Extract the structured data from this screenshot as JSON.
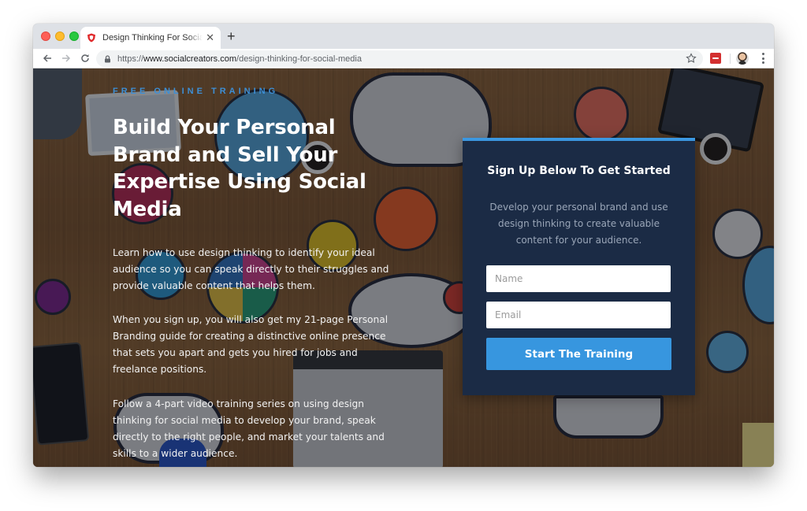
{
  "browser": {
    "tab": {
      "title": "Design Thinking For Social Media",
      "favicon": "shield-favicon-icon",
      "close_glyph": "✕"
    },
    "new_tab_glyph": "+",
    "address": {
      "scheme": "https://",
      "host": "www.socialcreators.com",
      "path": "/design-thinking-for-social-media"
    },
    "icons": {
      "back": "arrow-left-icon",
      "forward": "arrow-right-icon",
      "reload": "reload-icon",
      "lock": "lock-icon",
      "bookmark": "star-icon",
      "extension": "extension-icon",
      "profile": "avatar",
      "menu": "kebab-menu-icon"
    }
  },
  "hero": {
    "eyebrow": "FREE ONLINE TRAINING",
    "headline": "Build Your Personal Brand and Sell Your Expertise Using Social Media",
    "paragraphs": [
      "Learn how to use design thinking to identify your ideal audience so you can speak directly to their struggles and provide valuable content that helps them.",
      "When you sign up, you will also get my 21-page Personal Branding guide for creating a distinctive online presence that sets you apart and gets you hired for jobs and freelance positions.",
      "Follow a 4-part video training series on using design thinking for social media to develop your brand, speak directly to the right people, and market your talents and skills to a wider audience."
    ]
  },
  "signup": {
    "title": "Sign Up Below To Get Started",
    "description": "Develop your personal brand and use design thinking to create valuable content for your audience.",
    "name_field": {
      "placeholder": "Name",
      "value": ""
    },
    "email_field": {
      "placeholder": "Email",
      "value": ""
    },
    "submit_label": "Start The Training",
    "colors": {
      "card": "#1b2b45",
      "accent": "#3796df",
      "eyebrow": "#3d8fd6"
    }
  }
}
